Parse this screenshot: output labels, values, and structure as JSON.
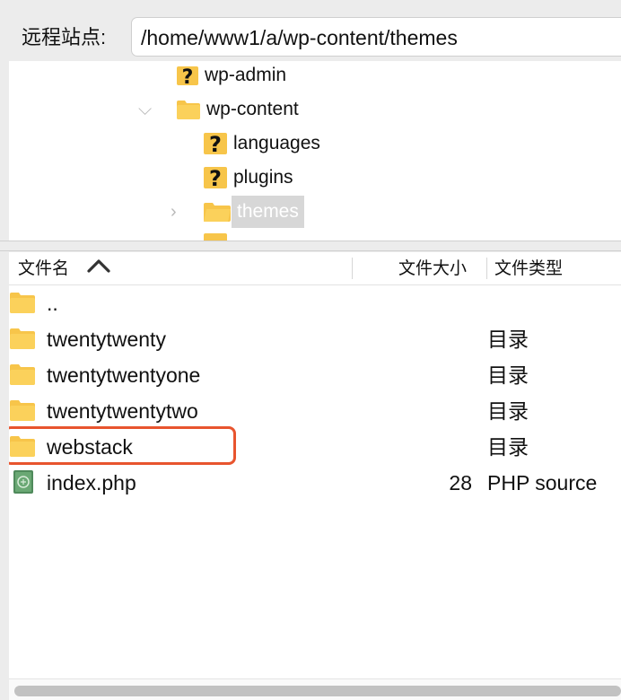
{
  "remote_site": {
    "label": "远程站点:",
    "path": "/home/www1/a/wp-content/themes"
  },
  "tree": {
    "items": [
      {
        "label": "wp-admin",
        "icon": "unknown-folder-icon"
      },
      {
        "label": "wp-content",
        "icon": "folder-icon",
        "expanded": true
      },
      {
        "label": "languages",
        "icon": "unknown-folder-icon"
      },
      {
        "label": "plugins",
        "icon": "unknown-folder-icon"
      },
      {
        "label": "themes",
        "icon": "folder-icon",
        "selected": true
      }
    ]
  },
  "file_list": {
    "columns": {
      "name": "文件名",
      "size": "文件大小",
      "type": "文件类型"
    },
    "sort": "name-ascending",
    "rows": [
      {
        "name": "..",
        "size": "",
        "type": "",
        "icon": "folder-icon"
      },
      {
        "name": "twentytwenty",
        "size": "",
        "type": "目录",
        "icon": "folder-icon"
      },
      {
        "name": "twentytwentyone",
        "size": "",
        "type": "目录",
        "icon": "folder-icon"
      },
      {
        "name": "twentytwentytwo",
        "size": "",
        "type": "目录",
        "icon": "folder-icon"
      },
      {
        "name": "webstack",
        "size": "",
        "type": "目录",
        "icon": "folder-icon",
        "highlighted": true
      },
      {
        "name": "index.php",
        "size": "28",
        "type": "PHP source",
        "icon": "php-file-icon"
      }
    ]
  },
  "colors": {
    "folder": "#f7c54a",
    "highlight_border": "#e8542e",
    "selection": "#d7d7d7"
  }
}
